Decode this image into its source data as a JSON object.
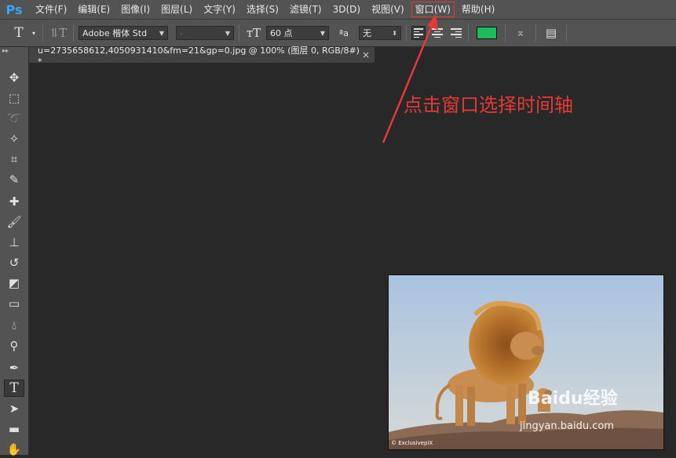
{
  "app": {
    "logo": "Ps"
  },
  "menu": {
    "items": [
      "文件(F)",
      "编辑(E)",
      "图像(I)",
      "图层(L)",
      "文字(Y)",
      "选择(S)",
      "滤镜(T)",
      "3D(D)",
      "视图(V)",
      "窗口(W)",
      "帮助(H)"
    ],
    "highlighted_index": 9
  },
  "options": {
    "font_family": "Adobe 楷体 Std",
    "font_style": "-",
    "font_size": "60 点",
    "antialias_glyph": "ªa",
    "antialias": "无",
    "text_color": "#1dbb5a"
  },
  "document": {
    "tab_title": "u=2735658612,4050931410&fm=21&gp=0.jpg @ 100% (图层 0, RGB/8#) *",
    "close_glyph": "×"
  },
  "annotation": {
    "text": "点击窗口选择时间轴",
    "color": "#e53935"
  },
  "image": {
    "watermark_brand": "Baidu经验",
    "watermark_url": "jingyan.baidu.com",
    "credit": "© ExclusivepiX"
  },
  "tools": [
    "move-tool",
    "marquee-tool",
    "lasso-tool",
    "magic-wand-tool",
    "crop-tool",
    "eyedropper-tool",
    "healing-brush-tool",
    "brush-tool",
    "clone-stamp-tool",
    "history-brush-tool",
    "eraser-tool",
    "gradient-tool",
    "blur-tool",
    "dodge-tool",
    "pen-tool",
    "type-tool",
    "path-selection-tool",
    "rectangle-tool",
    "hand-tool"
  ],
  "active_tool": "type-tool"
}
